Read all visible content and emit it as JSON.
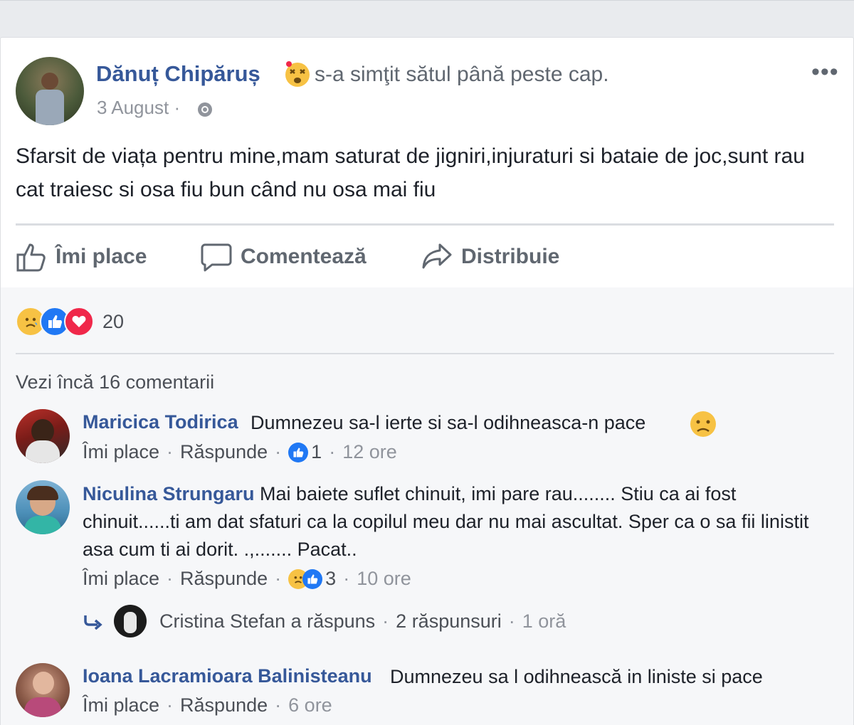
{
  "post": {
    "author": "Dănuț Chipăruș",
    "feeling": "s-a simţit sătul până peste cap.",
    "date": "3 August",
    "date_sep": "·",
    "more": "•••",
    "text": "Sfarsit de viața pentru mine,mam saturat de jigniri,injuraturi si bataie de joc,sunt rau cat traiesc si osa fiu bun când nu osa mai fiu"
  },
  "actions": {
    "like": "Îmi place",
    "comment": "Comentează",
    "share": "Distribuie"
  },
  "reactions": {
    "count": "20",
    "types": [
      "sad",
      "like",
      "love"
    ],
    "colors": {
      "like": "#2078f4",
      "love": "#f0284a",
      "sad": "#f7c244"
    }
  },
  "comments_section": {
    "view_more": "Vezi încă 16 comentarii",
    "comments": [
      {
        "name": "Maricica Todirica",
        "text": "Dumnezeu sa-l ierte si sa-l odihneasca-n pace",
        "like": "Îmi place",
        "reply": "Răspunde",
        "reaction_count": "1",
        "time": "12 ore"
      },
      {
        "name": "Niculina Strungaru",
        "text": "Mai baiete suflet chinuit, imi pare rau........ Stiu ca ai fost chinuit......ti am dat sfaturi ca la copilul meu dar nu mai ascultat. Sper ca o sa fii linistit asa cum ti ai dorit. .,....... Pacat..",
        "like": "Îmi place",
        "reply": "Răspunde",
        "reaction_count": "3",
        "time": "10 ore",
        "replies_summary": {
          "text": "Cristina Stefan a răspuns",
          "count": "2 răspunsuri",
          "time": "1 oră"
        }
      },
      {
        "name": "Ioana Lacramioara Balinisteanu",
        "text": "Dumnezeu sa l odihnească in liniste si pace",
        "like": "Îmi place",
        "reply": "Răspunde",
        "time": "6 ore"
      }
    ]
  }
}
